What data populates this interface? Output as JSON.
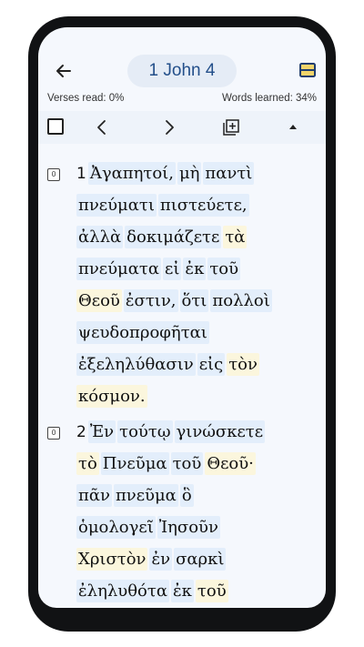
{
  "header": {
    "back_icon": "arrow-left-icon",
    "title": "1 John 4",
    "notes_icon": "notes-icon"
  },
  "stats": {
    "verses_read": "Verses read: 0%",
    "words_learned": "Words learned: 34%"
  },
  "toolbar": {
    "prev_icon": "chevron-left-icon",
    "next_icon": "chevron-right-icon",
    "copy_icon": "copy-add-icon",
    "collapse_icon": "triangle-up-icon"
  },
  "verses": [
    {
      "number": "1",
      "icon_label": "0",
      "lines": [
        [
          {
            "t": "Ἀγαπητοί,",
            "h": "b"
          },
          {
            "t": "μὴ",
            "h": "b"
          },
          {
            "t": "παντὶ",
            "h": "b"
          }
        ],
        [
          {
            "t": "πνεύματι",
            "h": "b"
          },
          {
            "t": "πιστεύετε,",
            "h": "b"
          }
        ],
        [
          {
            "t": "ἀλλὰ",
            "h": "b"
          },
          {
            "t": "δοκιμάζετε",
            "h": "b"
          },
          {
            "t": "τὰ",
            "h": "y"
          }
        ],
        [
          {
            "t": "πνεύματα",
            "h": "b"
          },
          {
            "t": "εἰ",
            "h": "b"
          },
          {
            "t": "ἐκ",
            "h": "b"
          },
          {
            "t": "τοῦ",
            "h": "b"
          }
        ],
        [
          {
            "t": "Θεοῦ",
            "h": "y"
          },
          {
            "t": "ἐστιν,",
            "h": "b"
          },
          {
            "t": "ὅτι",
            "h": "b"
          },
          {
            "t": "πολλοὶ",
            "h": "b"
          }
        ],
        [
          {
            "t": "ψευδοπροφῆται",
            "h": "b"
          }
        ],
        [
          {
            "t": "ἐξεληλύθασιν",
            "h": "b"
          },
          {
            "t": "εἰς",
            "h": "b"
          },
          {
            "t": "τὸν",
            "h": "y"
          }
        ],
        [
          {
            "t": "κόσμον.",
            "h": "y"
          }
        ]
      ]
    },
    {
      "number": "2",
      "icon_label": "0",
      "lines": [
        [
          {
            "t": "Ἐν",
            "h": "b"
          },
          {
            "t": "τούτῳ",
            "h": "b"
          },
          {
            "t": "γινώσκετε",
            "h": "b"
          }
        ],
        [
          {
            "t": "τὸ",
            "h": "y"
          },
          {
            "t": "Πνεῦμα",
            "h": "b"
          },
          {
            "t": "τοῦ",
            "h": "b"
          },
          {
            "t": "Θεοῦ·",
            "h": "y"
          }
        ],
        [
          {
            "t": "πᾶν",
            "h": "b"
          },
          {
            "t": "πνεῦμα",
            "h": "b"
          },
          {
            "t": "ὃ",
            "h": "b"
          }
        ],
        [
          {
            "t": "ὁμολογεῖ",
            "h": "b"
          },
          {
            "t": "Ἰησοῦν",
            "h": "b"
          }
        ],
        [
          {
            "t": "Χριστὸν",
            "h": "y"
          },
          {
            "t": "ἐν",
            "h": "b"
          },
          {
            "t": "σαρκὶ",
            "h": "b"
          }
        ],
        [
          {
            "t": "ἐληλυθότα",
            "h": "b"
          },
          {
            "t": "ἐκ",
            "h": "b"
          },
          {
            "t": "τοῦ",
            "h": "y"
          }
        ]
      ]
    }
  ]
}
